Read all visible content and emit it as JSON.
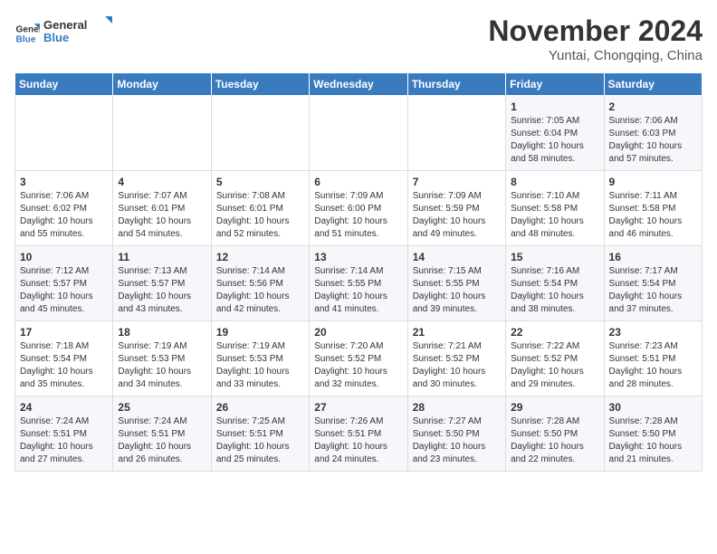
{
  "header": {
    "logo_line1": "General",
    "logo_line2": "Blue",
    "month": "November 2024",
    "location": "Yuntai, Chongqing, China"
  },
  "days_of_week": [
    "Sunday",
    "Monday",
    "Tuesday",
    "Wednesday",
    "Thursday",
    "Friday",
    "Saturday"
  ],
  "weeks": [
    [
      {
        "day": "",
        "content": ""
      },
      {
        "day": "",
        "content": ""
      },
      {
        "day": "",
        "content": ""
      },
      {
        "day": "",
        "content": ""
      },
      {
        "day": "",
        "content": ""
      },
      {
        "day": "1",
        "content": "Sunrise: 7:05 AM\nSunset: 6:04 PM\nDaylight: 10 hours and 58 minutes."
      },
      {
        "day": "2",
        "content": "Sunrise: 7:06 AM\nSunset: 6:03 PM\nDaylight: 10 hours and 57 minutes."
      }
    ],
    [
      {
        "day": "3",
        "content": "Sunrise: 7:06 AM\nSunset: 6:02 PM\nDaylight: 10 hours and 55 minutes."
      },
      {
        "day": "4",
        "content": "Sunrise: 7:07 AM\nSunset: 6:01 PM\nDaylight: 10 hours and 54 minutes."
      },
      {
        "day": "5",
        "content": "Sunrise: 7:08 AM\nSunset: 6:01 PM\nDaylight: 10 hours and 52 minutes."
      },
      {
        "day": "6",
        "content": "Sunrise: 7:09 AM\nSunset: 6:00 PM\nDaylight: 10 hours and 51 minutes."
      },
      {
        "day": "7",
        "content": "Sunrise: 7:09 AM\nSunset: 5:59 PM\nDaylight: 10 hours and 49 minutes."
      },
      {
        "day": "8",
        "content": "Sunrise: 7:10 AM\nSunset: 5:58 PM\nDaylight: 10 hours and 48 minutes."
      },
      {
        "day": "9",
        "content": "Sunrise: 7:11 AM\nSunset: 5:58 PM\nDaylight: 10 hours and 46 minutes."
      }
    ],
    [
      {
        "day": "10",
        "content": "Sunrise: 7:12 AM\nSunset: 5:57 PM\nDaylight: 10 hours and 45 minutes."
      },
      {
        "day": "11",
        "content": "Sunrise: 7:13 AM\nSunset: 5:57 PM\nDaylight: 10 hours and 43 minutes."
      },
      {
        "day": "12",
        "content": "Sunrise: 7:14 AM\nSunset: 5:56 PM\nDaylight: 10 hours and 42 minutes."
      },
      {
        "day": "13",
        "content": "Sunrise: 7:14 AM\nSunset: 5:55 PM\nDaylight: 10 hours and 41 minutes."
      },
      {
        "day": "14",
        "content": "Sunrise: 7:15 AM\nSunset: 5:55 PM\nDaylight: 10 hours and 39 minutes."
      },
      {
        "day": "15",
        "content": "Sunrise: 7:16 AM\nSunset: 5:54 PM\nDaylight: 10 hours and 38 minutes."
      },
      {
        "day": "16",
        "content": "Sunrise: 7:17 AM\nSunset: 5:54 PM\nDaylight: 10 hours and 37 minutes."
      }
    ],
    [
      {
        "day": "17",
        "content": "Sunrise: 7:18 AM\nSunset: 5:54 PM\nDaylight: 10 hours and 35 minutes."
      },
      {
        "day": "18",
        "content": "Sunrise: 7:19 AM\nSunset: 5:53 PM\nDaylight: 10 hours and 34 minutes."
      },
      {
        "day": "19",
        "content": "Sunrise: 7:19 AM\nSunset: 5:53 PM\nDaylight: 10 hours and 33 minutes."
      },
      {
        "day": "20",
        "content": "Sunrise: 7:20 AM\nSunset: 5:52 PM\nDaylight: 10 hours and 32 minutes."
      },
      {
        "day": "21",
        "content": "Sunrise: 7:21 AM\nSunset: 5:52 PM\nDaylight: 10 hours and 30 minutes."
      },
      {
        "day": "22",
        "content": "Sunrise: 7:22 AM\nSunset: 5:52 PM\nDaylight: 10 hours and 29 minutes."
      },
      {
        "day": "23",
        "content": "Sunrise: 7:23 AM\nSunset: 5:51 PM\nDaylight: 10 hours and 28 minutes."
      }
    ],
    [
      {
        "day": "24",
        "content": "Sunrise: 7:24 AM\nSunset: 5:51 PM\nDaylight: 10 hours and 27 minutes."
      },
      {
        "day": "25",
        "content": "Sunrise: 7:24 AM\nSunset: 5:51 PM\nDaylight: 10 hours and 26 minutes."
      },
      {
        "day": "26",
        "content": "Sunrise: 7:25 AM\nSunset: 5:51 PM\nDaylight: 10 hours and 25 minutes."
      },
      {
        "day": "27",
        "content": "Sunrise: 7:26 AM\nSunset: 5:51 PM\nDaylight: 10 hours and 24 minutes."
      },
      {
        "day": "28",
        "content": "Sunrise: 7:27 AM\nSunset: 5:50 PM\nDaylight: 10 hours and 23 minutes."
      },
      {
        "day": "29",
        "content": "Sunrise: 7:28 AM\nSunset: 5:50 PM\nDaylight: 10 hours and 22 minutes."
      },
      {
        "day": "30",
        "content": "Sunrise: 7:28 AM\nSunset: 5:50 PM\nDaylight: 10 hours and 21 minutes."
      }
    ]
  ]
}
